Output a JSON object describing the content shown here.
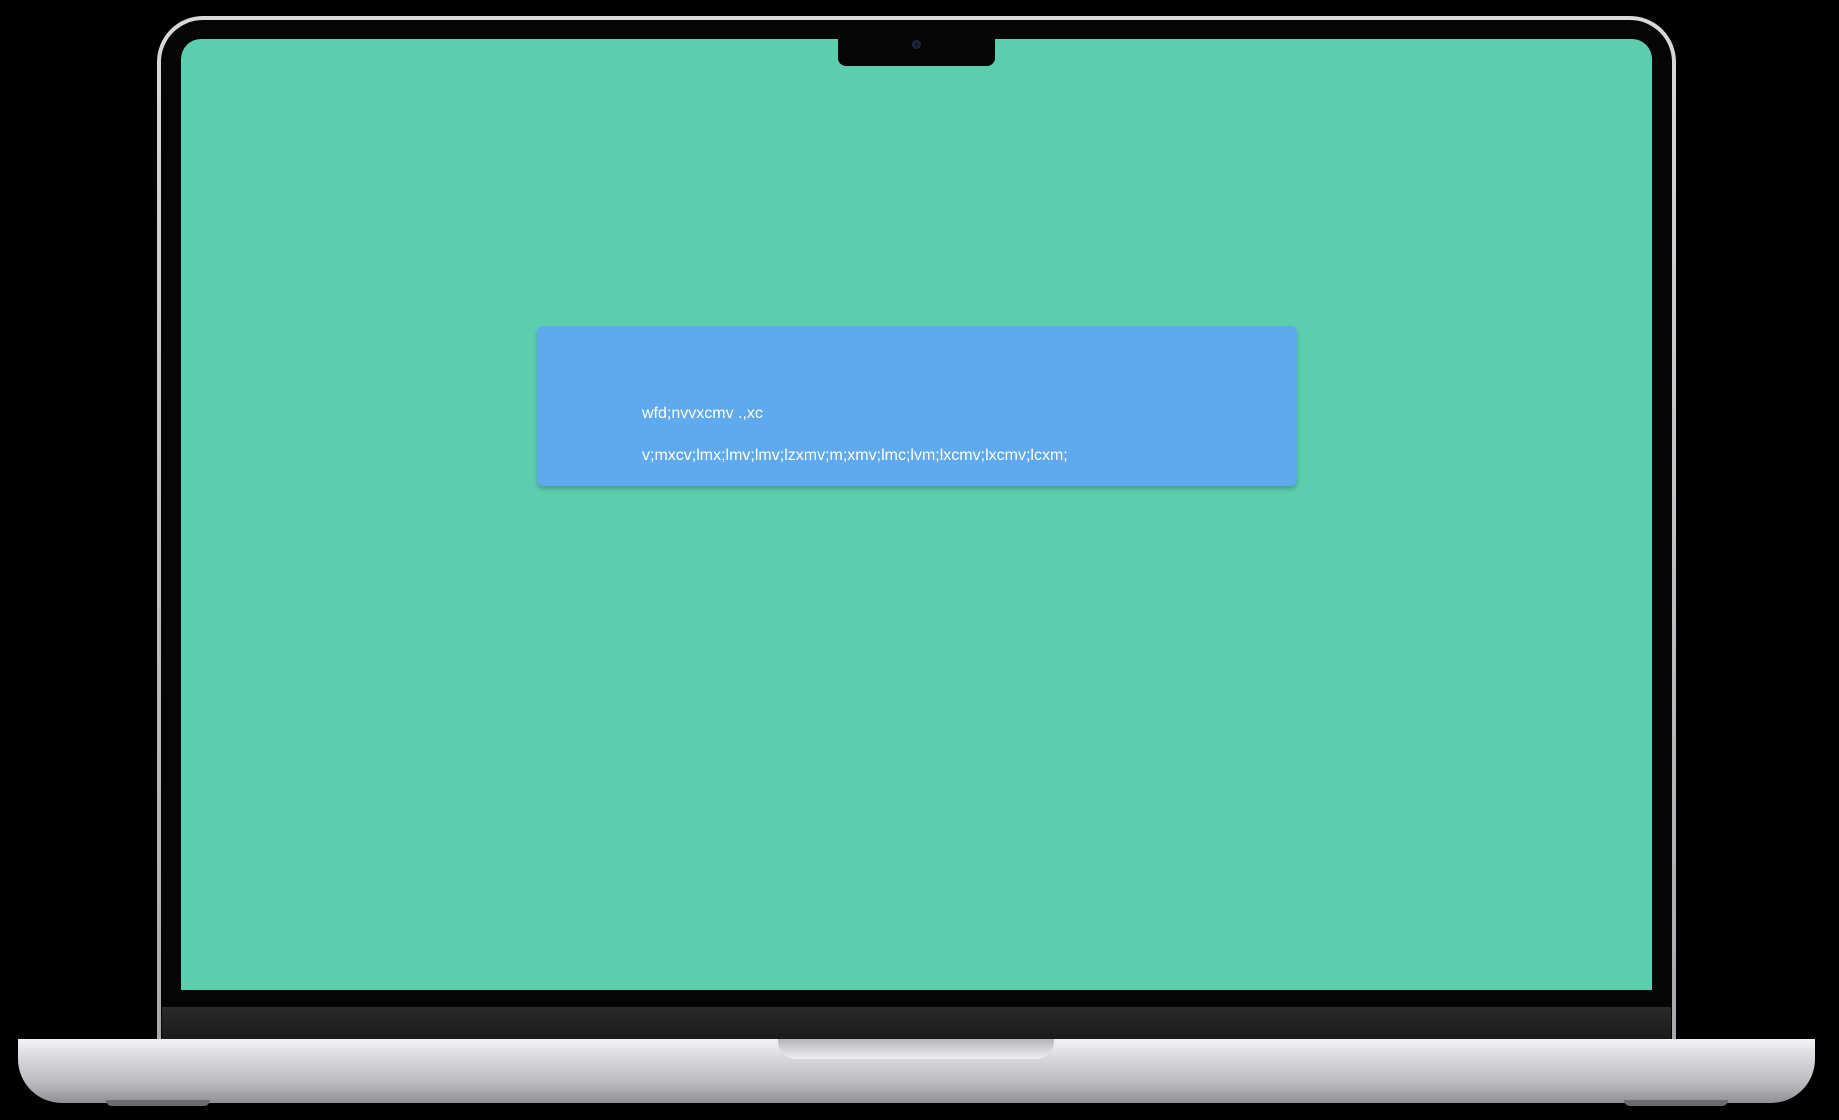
{
  "card": {
    "line1": "wfd;nvvxcmv .,xc",
    "line2": "v;mxcv;lmx;lmv;lmv;lzxmv;m;xmv;lmc;lvm;lxcmv;lxcmv;lcxm;"
  },
  "colors": {
    "screen_background": "#5bcfad",
    "card_background": "#5fa9ee",
    "card_text": "#ffffff",
    "device_frame": "#000000"
  }
}
